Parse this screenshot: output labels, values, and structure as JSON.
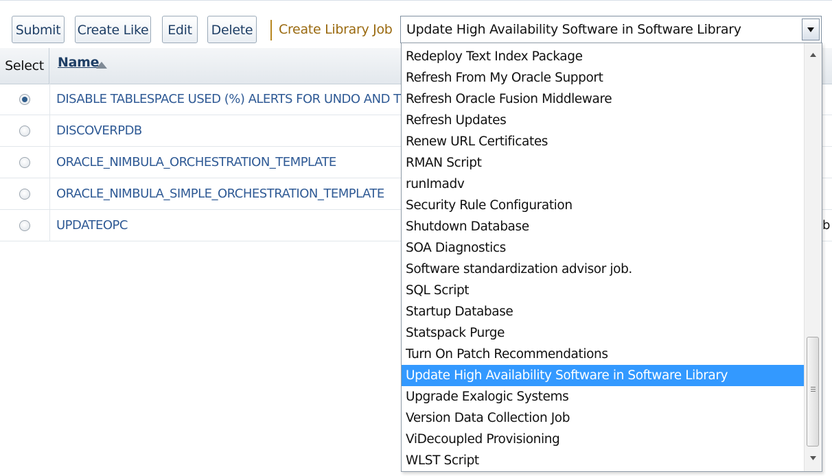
{
  "toolbar": {
    "submit_label": "Submit",
    "create_like_label": "Create Like",
    "edit_label": "Edit",
    "delete_label": "Delete",
    "create_library_job_label": "Create Library Job"
  },
  "job_type_select": {
    "selected_value": "Update High Availability Software in Software Library"
  },
  "table": {
    "columns": {
      "select": "Select",
      "name": "Name"
    },
    "sort_icon": "sort-ascending-icon",
    "rows": [
      {
        "name": "DISABLE TABLESPACE USED (%) ALERTS FOR UNDO AND TE",
        "selected": true
      },
      {
        "name": "DISCOVERPDB",
        "selected": false
      },
      {
        "name": "ORACLE_NIMBULA_ORCHESTRATION_TEMPLATE",
        "selected": false
      },
      {
        "name": "ORACLE_NIMBULA_SIMPLE_ORCHESTRATION_TEMPLATE",
        "selected": false
      },
      {
        "name": "UPDATEOPC",
        "selected": false,
        "extra": "b"
      }
    ]
  },
  "dropdown": {
    "options": [
      "Redeploy Text Index Package",
      "Refresh From My Oracle Support",
      "Refresh Oracle Fusion Middleware",
      "Refresh Updates",
      "Renew URL Certificates",
      "RMAN Script",
      "runImadv",
      "Security Rule Configuration",
      "Shutdown Database",
      "SOA Diagnostics",
      "Software standardization advisor job.",
      "SQL Script",
      "Startup Database",
      "Statspack Purge",
      "Turn On Patch Recommendations",
      "Update High Availability Software in Software Library",
      "Upgrade Exalogic Systems",
      "Version Data Collection Job",
      "ViDecoupled Provisioning",
      "WLST Script"
    ],
    "selected_index": 15
  },
  "colors": {
    "link": "#2f5a95",
    "accent_link": "#9a6a10",
    "selection": "#3399ff"
  }
}
